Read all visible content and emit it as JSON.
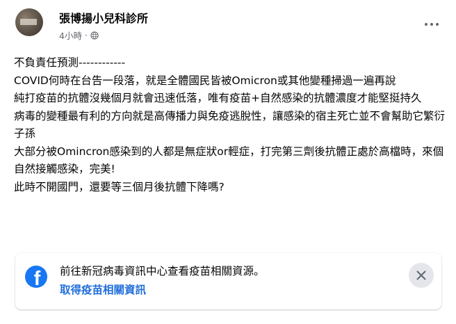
{
  "post": {
    "author": "張博揚小兒科診所",
    "timestamp": "4小時",
    "separator": "·",
    "privacy_icon": "globe-icon",
    "more_icon": "more-options-icon",
    "body_lines": [
      "不負責任預測------------",
      "COVID何時在台告一段落，就是全體國民皆被Omicron或其他變種掃過一遍再說",
      "純打疫苗的抗體沒幾個月就會迅速低落，唯有疫苗+自然感染的抗體濃度才能堅挺持久",
      "病毒的變種最有利的方向就是高傳播力與免疫逃脫性，讓感染的宿主死亡並不會幫助它繁衍子孫",
      "大部分被Omincron感染到的人都是無症狀or輕症，打完第三劑後抗體正處於高檔時，來個自然接觸感染，完美!",
      "此時不開國門，還要等三個月後抗體下降嗎?"
    ]
  },
  "covid_info_card": {
    "logo_icon": "facebook-logo-icon",
    "logo_letter": "f",
    "text": "前往新冠病毒資訊中心查看疫苗相關資源。",
    "link_label": "取得疫苗相關資訊",
    "close_icon": "close-icon"
  },
  "colors": {
    "facebook_blue": "#1877f2",
    "link_blue": "#216fdb",
    "meta_gray": "#65676b",
    "close_button_bg": "#e4e6eb"
  }
}
